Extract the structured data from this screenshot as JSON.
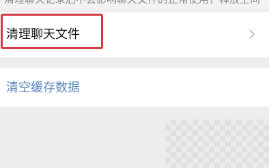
{
  "top_hint": {
    "text": "清理聊天记录后不会影响聊天文件的正常使用，释放空间"
  },
  "settings": {
    "clear_chat_files_label": "清理聊天文件",
    "clear_cache_label": "清空缓存数据"
  },
  "icons": {
    "chevron": "chevron-right-icon"
  },
  "colors": {
    "highlight": "#d13a3f",
    "link": "#5b86bb"
  }
}
